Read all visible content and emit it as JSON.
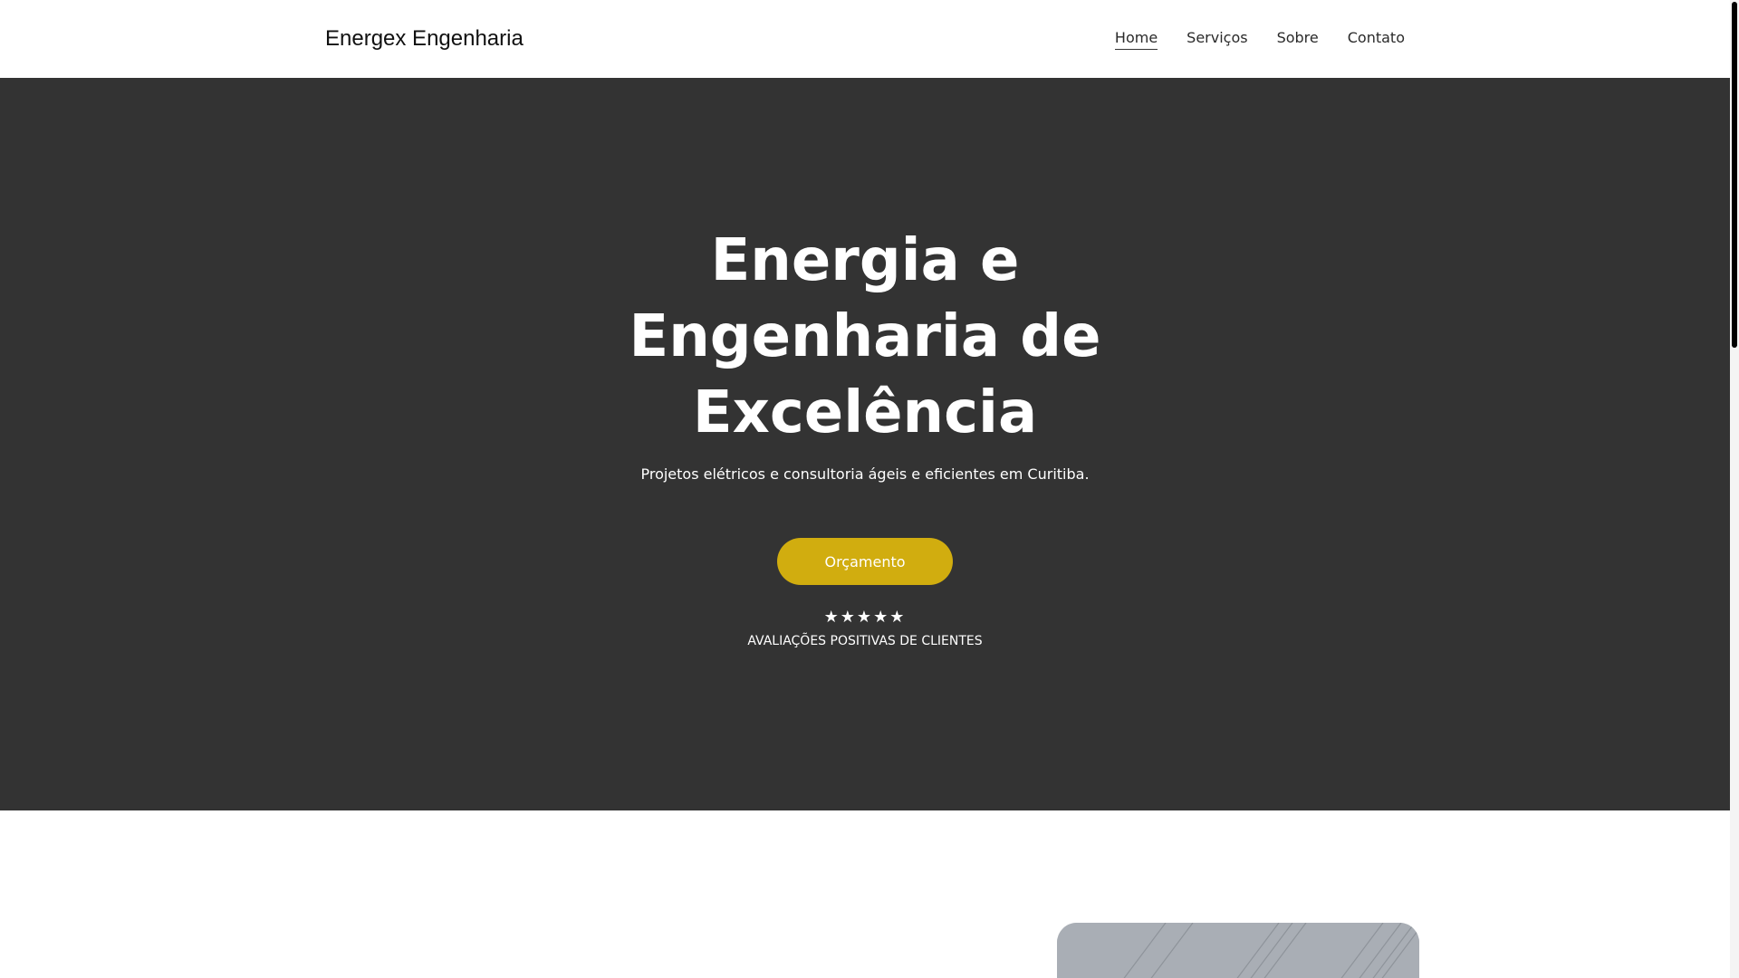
{
  "header": {
    "brand": "Energex Engenharia",
    "nav": [
      "Home",
      "Serviços",
      "Sobre",
      "Contato"
    ],
    "active_nav": "Home"
  },
  "hero": {
    "title_lines": [
      "Energia e",
      "Engenharia de",
      "Excelência"
    ],
    "subtitle": "Projetos elétricos e consultoria ágeis e eficientes em Curitiba.",
    "cta_label": "Orçamento",
    "stars": "★★★★★",
    "reviews_label": "AVALIAÇÕES POSITIVAS DE CLIENTES"
  },
  "colors": {
    "hero_background": "#333333",
    "accent": "#d1ad0f",
    "page_background": "#ffffff"
  },
  "icons": {
    "rating": "star-icon"
  }
}
